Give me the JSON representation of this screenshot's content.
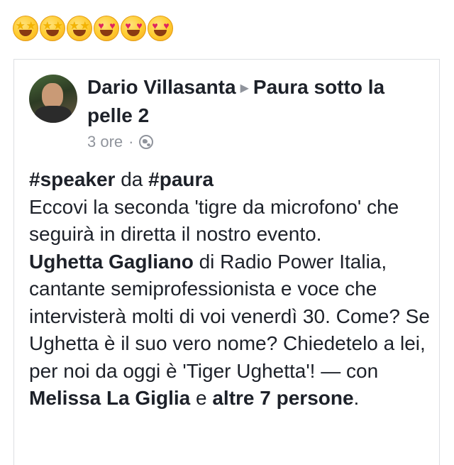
{
  "emojis": [
    {
      "name": "star-struck",
      "glyph": "★"
    },
    {
      "name": "star-struck",
      "glyph": "★"
    },
    {
      "name": "star-struck",
      "glyph": "★"
    },
    {
      "name": "heart-eyes",
      "glyph": "♥"
    },
    {
      "name": "heart-eyes",
      "glyph": "♥"
    },
    {
      "name": "heart-eyes",
      "glyph": "♥"
    }
  ],
  "post": {
    "author": "Dario Villasanta",
    "arrow_icon": "triangle-right-icon",
    "group": "Paura sotto la pelle 2",
    "time": "3 ore",
    "separator": "·",
    "privacy_icon": "globe-icon",
    "hashtag1": "#speaker",
    "word_da": "da",
    "hashtag2": "#paura",
    "line1": "Eccovi la seconda 'tigre da microfono' che seguirà in diretta il nostro evento.",
    "person": "Ughetta Gagliano",
    "line2": "di Radio Power Italia, cantante semiprofessionista e voce che intervisterà molti di voi venerdì 30. Come? Se Ughetta è il suo vero nome? Chiedetelo a lei, per noi da oggi è 'Tiger Ughetta'! — con",
    "tagged": "Melissa La Giglia",
    "word_e": "e",
    "others": "altre 7 persone",
    "end": "."
  },
  "colors": {
    "text": "#1d2129",
    "meta": "#90949c",
    "border": "#dddfe2"
  }
}
